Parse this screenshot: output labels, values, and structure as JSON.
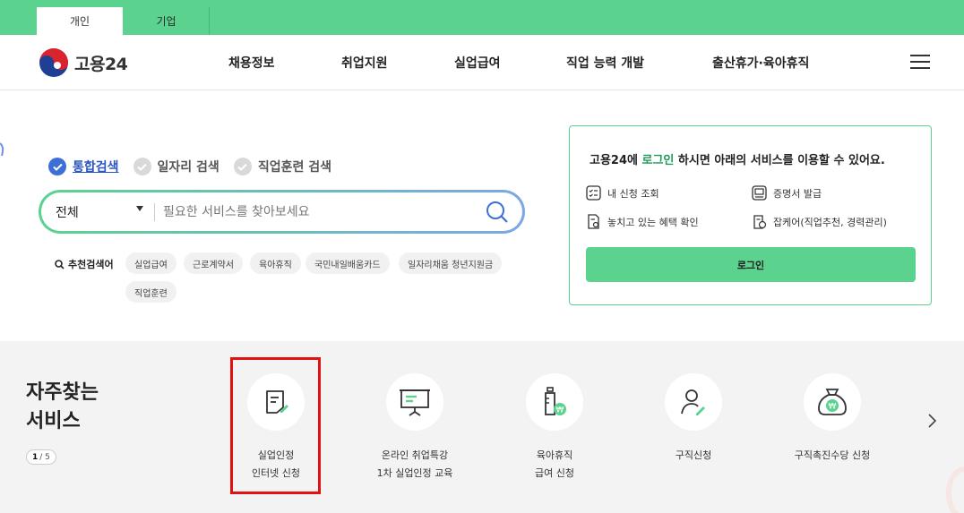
{
  "top_tabs": [
    {
      "label": "개인",
      "active": true
    },
    {
      "label": "기업",
      "active": false
    }
  ],
  "header": {
    "logo_text": "고용24",
    "nav": [
      "채용정보",
      "취업지원",
      "실업급여",
      "직업 능력 개발",
      "출산휴가·육아휴직"
    ],
    "menu_icon": "hamburger-icon"
  },
  "search": {
    "tabs": [
      "통합검색",
      "일자리 검색",
      "직업훈련 검색"
    ],
    "active_tab": "통합검색",
    "scope_value": "전체",
    "placeholder": "필요한 서비스를 찾아보세요",
    "recommend_label": "추천검색어",
    "recommend_chips": [
      "실업급여",
      "근로계약서",
      "육아휴직",
      "국민내일배움카드",
      "일자리채움 청년지원금",
      "직업훈련"
    ]
  },
  "login_card": {
    "title_prefix": "고용24에 ",
    "title_highlight": "로그인",
    "title_suffix": " 하시면 아래의 서비스를 이용할 수 있어요.",
    "services": [
      "내 신청 조회",
      "증명서 발급",
      "놓치고 있는 혜택 확인",
      "잡케어(직업추천, 경력관리)"
    ],
    "login_button": "로그인"
  },
  "frequent": {
    "title_line1": "자주찾는",
    "title_line2": "서비스",
    "pager_current": "1",
    "pager_total": "/ 5",
    "items": [
      {
        "line1": "실업인정",
        "line2": "인터넷 신청",
        "icon": "document-edit-icon"
      },
      {
        "line1": "온라인 취업특강",
        "line2": "1차 실업인정 교육",
        "icon": "presentation-board-icon"
      },
      {
        "line1": "육아휴직",
        "line2": "급여 신청",
        "icon": "baby-bottle-icon"
      },
      {
        "line1": "구직신청",
        "line2": "",
        "icon": "person-edit-icon"
      },
      {
        "line1": "구직촉진수당 신청",
        "line2": "",
        "icon": "money-bag-icon"
      }
    ]
  },
  "colors": {
    "brand_green": "#5cd28f",
    "highlight_red": "#e01212",
    "active_blue": "#2b55c6"
  }
}
